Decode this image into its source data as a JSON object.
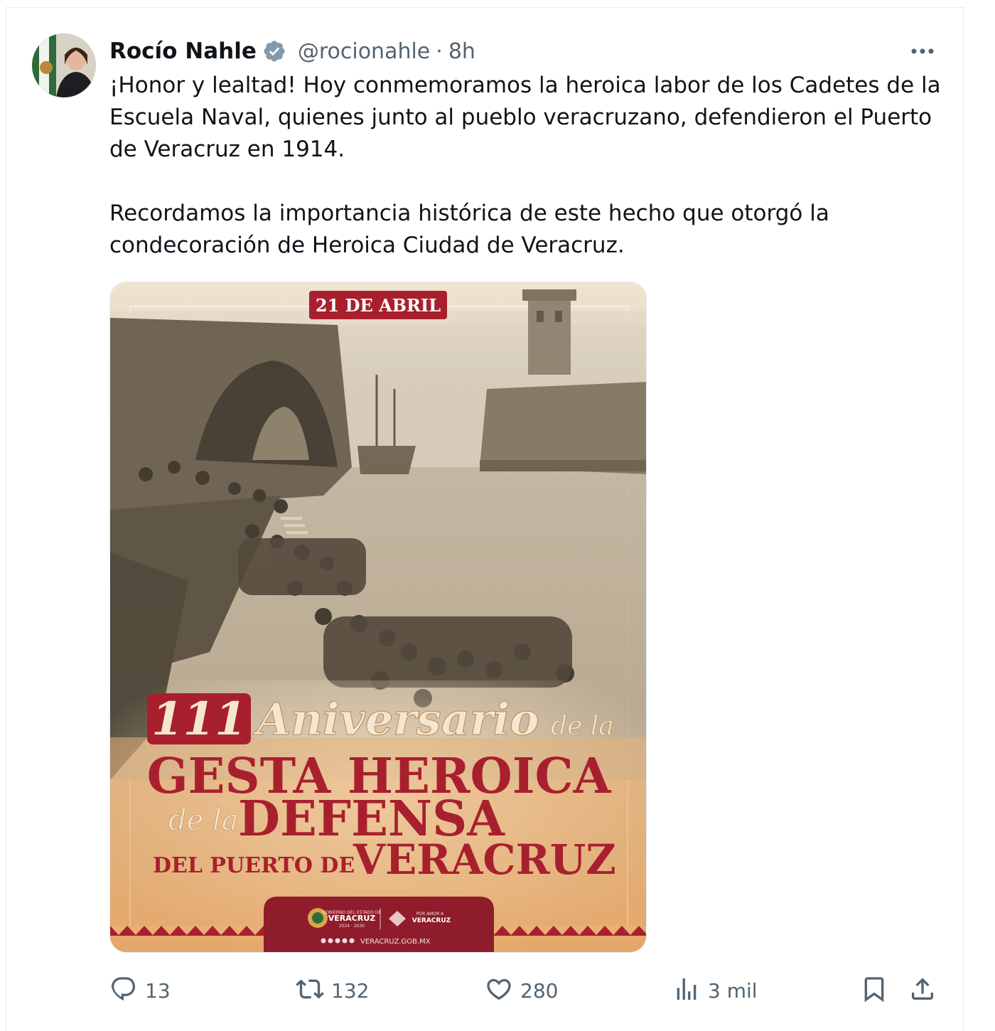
{
  "user": {
    "name": "Rocío Nahle",
    "handle": "@rocionahle",
    "separator": "·",
    "time": "8h"
  },
  "tweet": {
    "text": "¡Honor y lealtad! Hoy conmemoramos la heroica labor de los Cadetes de la\nEscuela Naval, quienes junto al pueblo veracruzano, defendieron el Puerto\nde Veracruz en 1914.\n\nRecordamos la importancia histórica de este hecho que otorgó la\ncondecoración de Heroica Ciudad de Veracruz."
  },
  "poster": {
    "date_badge": "21 DE ABRIL",
    "number": "111",
    "aniversario": "Aniversario",
    "de_la_1": "de la",
    "gesta": "GESTA HEROICA",
    "de_la_2": "de la",
    "defensa": "DEFENSA",
    "del_puerto": "DEL PUERTO DE",
    "veracruz": "VERACRUZ",
    "gov_line1": "GOBIERNO DEL ESTADO DE",
    "gov_name": "VERACRUZ",
    "gov_years": "2024 · 2030",
    "amor_line1": "POR AMOR A",
    "amor_name": "VERACRUZ",
    "website": "VERACRUZ.GOB.MX"
  },
  "actions": {
    "replies": "13",
    "reposts": "132",
    "likes": "280",
    "views": "3 mil"
  },
  "colors": {
    "text": "#0f1419",
    "secondary": "#536471",
    "verified": "#829aab",
    "poster_red": "#a8202e",
    "poster_bg": "#e8a96b"
  },
  "icons": [
    "verified-badge-icon",
    "more-icon",
    "reply-icon",
    "repost-icon",
    "like-icon",
    "views-icon",
    "bookmark-icon",
    "share-icon"
  ]
}
